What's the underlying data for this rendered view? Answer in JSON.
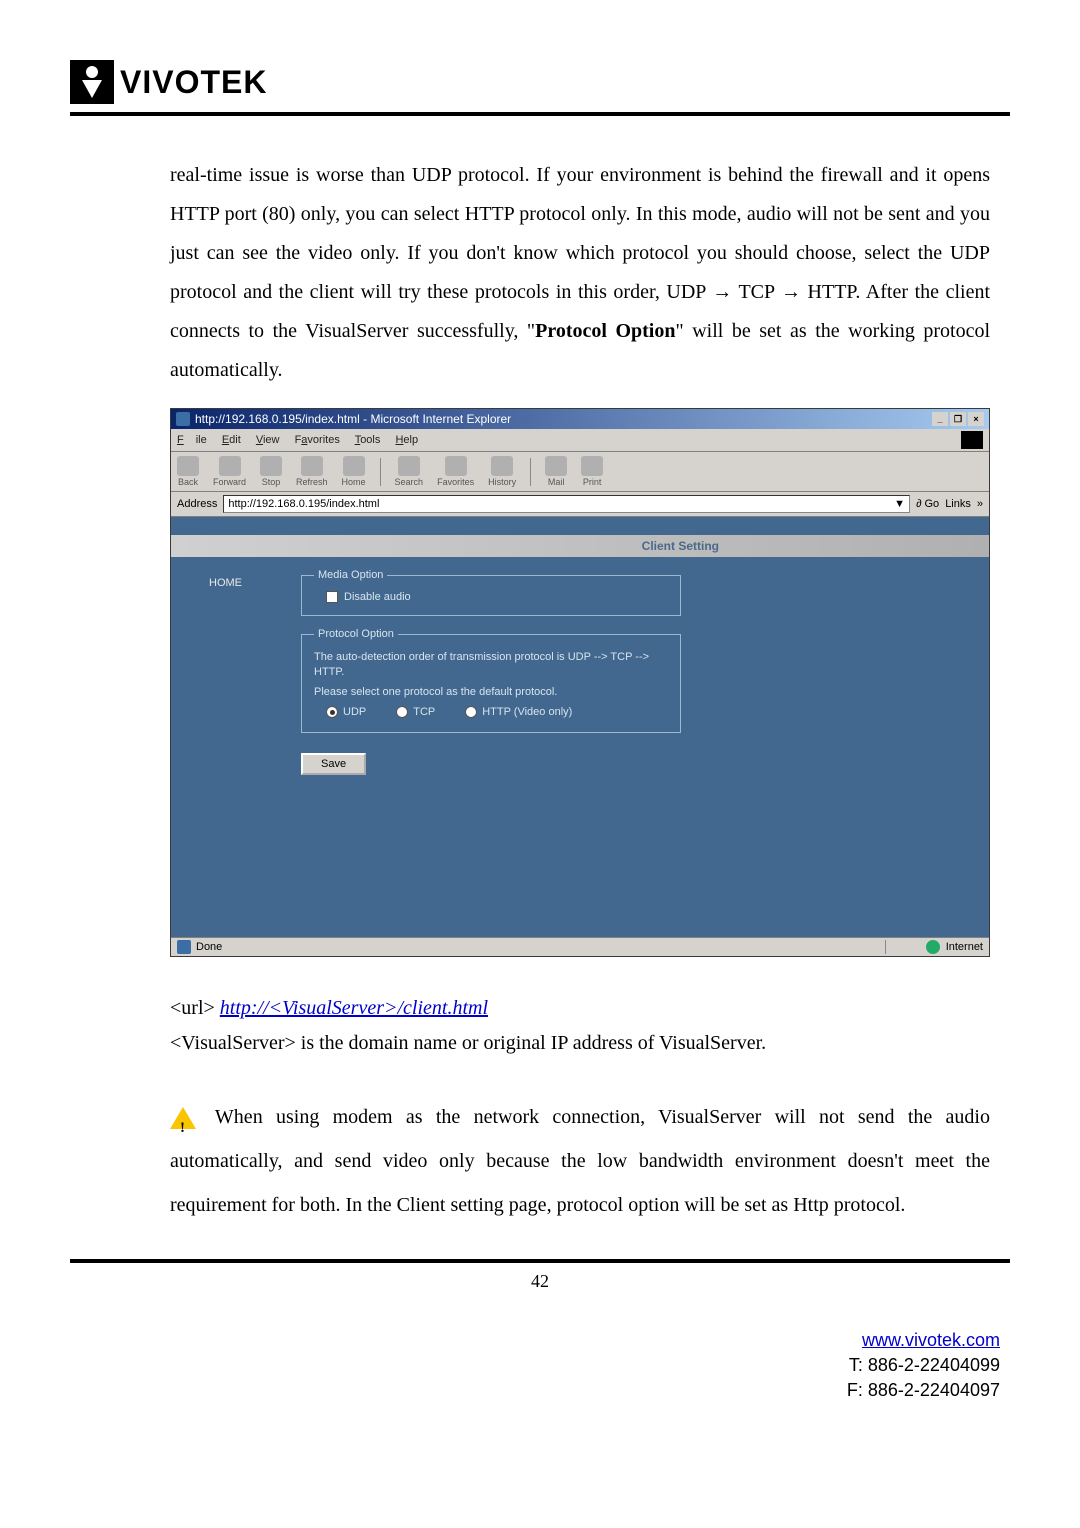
{
  "logo": {
    "text": "VIVOTEK"
  },
  "para1": "real-time issue is worse than UDP protocol. If your environment is behind the firewall and it opens HTTP port (80) only, you can select HTTP protocol only. In this mode, audio will not be sent and you just can see the video only. If you don't know which protocol you should choose, select the UDP protocol and the client will try these protocols in this order, UDP → TCP → HTTP. After the client connects to the VisualServer successfully, \"",
  "para1_bold": "Protocol Option",
  "para1_tail": "\" will be set as the working protocol automatically.",
  "ie": {
    "title": "http://192.168.0.195/index.html - Microsoft Internet Explorer",
    "menu": {
      "file": "File",
      "edit": "Edit",
      "view": "View",
      "favorites": "Favorites",
      "tools": "Tools",
      "help": "Help"
    },
    "toolbar": {
      "back": "Back",
      "forward": "Forward",
      "stop": "Stop",
      "refresh": "Refresh",
      "home": "Home",
      "search": "Search",
      "favorites": "Favorites",
      "history": "History",
      "mail": "Mail",
      "print": "Print"
    },
    "address_label": "Address",
    "address_value": "http://192.168.0.195/index.html",
    "go": "Go",
    "links": "Links",
    "banner": "Client Setting",
    "home": "HOME",
    "media_legend": "Media Option",
    "disable_audio": "Disable audio",
    "proto_legend": "Protocol Option",
    "proto_text1": "The auto-detection order of transmission protocol is UDP --> TCP --> HTTP.",
    "proto_text2": "Please select one protocol as the default protocol.",
    "udp": "UDP",
    "tcp": "TCP",
    "http": "HTTP (Video only)",
    "save": "Save",
    "status_done": "Done",
    "status_zone": "Internet"
  },
  "url_prefix": "<url> ",
  "url_link": "http://<VisualServer>/client.html",
  "vs_desc": "<VisualServer> is the domain name or original IP address of VisualServer.",
  "warn_text": " When using modem as the network connection, VisualServer will not send the audio automatically, and send video only because the low bandwidth environment doesn't meet the requirement for both. In the Client setting page, protocol option will be set as Http protocol.",
  "page_num": "42",
  "footer": {
    "url": "www.vivotek.com",
    "tel": "T: 886-2-22404099",
    "fax": "F: 886-2-22404097"
  }
}
